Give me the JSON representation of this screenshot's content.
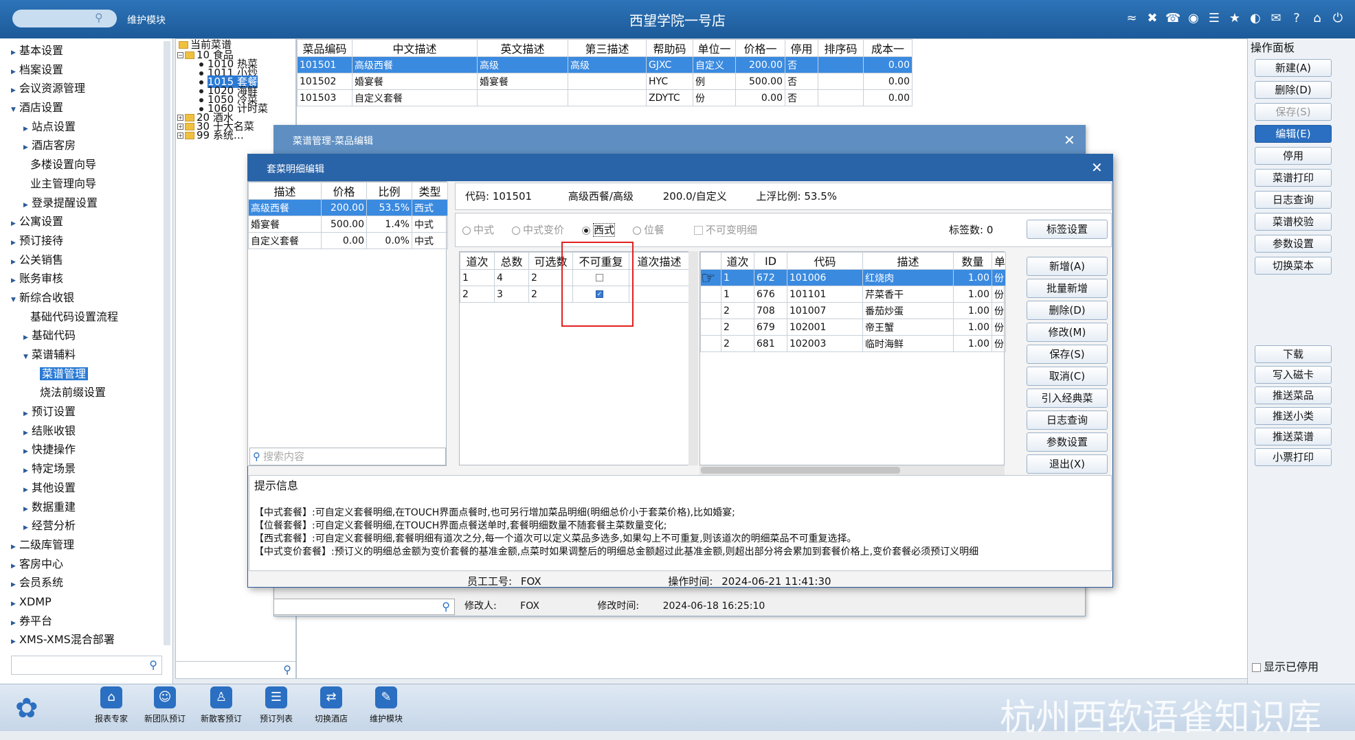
{
  "topbar": {
    "search_placeholder": "",
    "module_label": "维护模块",
    "title": "西望学院一号店",
    "icons": [
      "wifi-icon",
      "tools-icon",
      "phone-icon",
      "palette-icon",
      "menu-icon",
      "star-icon",
      "theme-icon",
      "mail-icon",
      "help-icon",
      "home-icon",
      "power-icon"
    ]
  },
  "left_nav": {
    "items": [
      {
        "label": "基本设置",
        "level": 0,
        "expanded": false
      },
      {
        "label": "档案设置",
        "level": 0,
        "expanded": false
      },
      {
        "label": "会议资源管理",
        "level": 0,
        "expanded": false
      },
      {
        "label": "酒店设置",
        "level": 0,
        "expanded": true
      },
      {
        "label": "站点设置",
        "level": 1,
        "expanded": false
      },
      {
        "label": "酒店客房",
        "level": 1,
        "expanded": false
      },
      {
        "label": "多楼设置向导",
        "level": 2
      },
      {
        "label": "业主管理向导",
        "level": 2
      },
      {
        "label": "登录提醒设置",
        "level": 1,
        "expanded": false
      },
      {
        "label": "公寓设置",
        "level": 0,
        "expanded": false
      },
      {
        "label": "预订接待",
        "level": 0,
        "expanded": false
      },
      {
        "label": "公关销售",
        "level": 0,
        "expanded": false
      },
      {
        "label": "账务审核",
        "level": 0,
        "expanded": false
      },
      {
        "label": "新综合收银",
        "level": 0,
        "expanded": true
      },
      {
        "label": "基础代码设置流程",
        "level": 2
      },
      {
        "label": "基础代码",
        "level": 1,
        "expanded": false
      },
      {
        "label": "菜谱辅料",
        "level": 1,
        "expanded": true
      },
      {
        "label": "菜谱管理",
        "level": 3,
        "active": true
      },
      {
        "label": "烧法前缀设置",
        "level": 3
      },
      {
        "label": "预订设置",
        "level": 1,
        "expanded": false
      },
      {
        "label": "结账收银",
        "level": 1,
        "expanded": false
      },
      {
        "label": "快捷操作",
        "level": 1,
        "expanded": false
      },
      {
        "label": "特定场景",
        "level": 1,
        "expanded": false
      },
      {
        "label": "其他设置",
        "level": 1,
        "expanded": false
      },
      {
        "label": "数据重建",
        "level": 1,
        "expanded": false
      },
      {
        "label": "经营分析",
        "level": 1,
        "expanded": false
      },
      {
        "label": "二级库管理",
        "level": 0,
        "expanded": false
      },
      {
        "label": "客房中心",
        "level": 0,
        "expanded": false
      },
      {
        "label": "会员系统",
        "level": 0,
        "expanded": false
      },
      {
        "label": "XDMP",
        "level": 0,
        "expanded": false
      },
      {
        "label": "券平台",
        "level": 0,
        "expanded": false
      },
      {
        "label": "XMS-XMS混合部署",
        "level": 0,
        "expanded": false
      }
    ]
  },
  "tree": {
    "root": "当前菜谱",
    "nodes": [
      {
        "label": "10 食品",
        "kind": "folder",
        "exp": "⊟"
      },
      {
        "label": "1010 热菜",
        "kind": "leaf"
      },
      {
        "label": "1011 小炒",
        "kind": "leaf"
      },
      {
        "label": "1015 套餐",
        "kind": "leaf",
        "selected": true
      },
      {
        "label": "1020 海鲜",
        "kind": "leaf"
      },
      {
        "label": "1050 冷菜",
        "kind": "leaf"
      },
      {
        "label": "1060 计时菜",
        "kind": "leaf"
      },
      {
        "label": "20 酒水",
        "kind": "folder",
        "exp": "⊞"
      },
      {
        "label": "30 十大名菜",
        "kind": "folder",
        "exp": "⊞"
      },
      {
        "label": "99 系统…",
        "kind": "folder",
        "exp": "⊞"
      }
    ]
  },
  "dish_table": {
    "headers": [
      "菜品编码",
      "中文描述",
      "英文描述",
      "第三描述",
      "帮助码",
      "单位一",
      "价格一",
      "停用",
      "排序码",
      "成本一"
    ],
    "rows": [
      [
        "101501",
        "高级西餐",
        "高级",
        "高级",
        "GJXC",
        "自定义",
        "200.00",
        "否",
        "",
        "0.00"
      ],
      [
        "101502",
        "婚宴餐",
        "婚宴餐",
        "",
        "HYC",
        "例",
        "500.00",
        "否",
        "",
        "0.00"
      ],
      [
        "101503",
        "自定义套餐",
        "",
        "",
        "ZDYTC",
        "份",
        "0.00",
        "否",
        "",
        "0.00"
      ]
    ]
  },
  "right_panel": {
    "title": "操作面板",
    "buttons": [
      {
        "label": "新建(A)"
      },
      {
        "label": "删除(D)"
      },
      {
        "label": "保存(S)",
        "disabled": true
      },
      {
        "label": "编辑(E)",
        "active": true
      },
      {
        "label": "停用"
      },
      {
        "label": "菜谱打印"
      },
      {
        "label": "日志查询"
      },
      {
        "label": "菜谱校验"
      },
      {
        "label": "参数设置"
      },
      {
        "label": "切换菜本"
      }
    ],
    "buttons2": [
      {
        "label": "下载"
      },
      {
        "label": "写入磁卡"
      },
      {
        "label": "推送菜品"
      },
      {
        "label": "推送小类"
      },
      {
        "label": "推送菜谱"
      },
      {
        "label": "小票打印"
      }
    ],
    "show_disabled": "显示已停用"
  },
  "back_dialog": {
    "title": "菜谱管理-菜品编辑",
    "modifier_label": "修改人:",
    "modifier": "FOX",
    "modify_time_label": "修改时间:",
    "modify_time": "2024-06-18 16:25:10"
  },
  "front_dialog": {
    "title": "套菜明细编辑",
    "pkg_headers": [
      "描述",
      "价格",
      "比例",
      "类型"
    ],
    "pkg_rows": [
      [
        "高级西餐",
        "200.00",
        "53.5%",
        "西式"
      ],
      [
        "婚宴餐",
        "500.00",
        "1.4%",
        "中式"
      ],
      [
        "自定义套餐",
        "0.00",
        "0.0%",
        "中式"
      ]
    ],
    "search_placeholder": "搜索内容",
    "info": {
      "code_label": "代码:",
      "code": "101501",
      "name": "高级西餐/高级",
      "price": "200.0/自定义",
      "ratio_label": "上浮比例:",
      "ratio": "53.5%"
    },
    "types": [
      {
        "label": "中式",
        "checked": false,
        "disabled": true
      },
      {
        "label": "中式变价",
        "checked": false,
        "disabled": true
      },
      {
        "label": "西式",
        "checked": true,
        "disabled": false
      },
      {
        "label": "位餐",
        "checked": false,
        "disabled": true
      }
    ],
    "non_variable_label": "不可变明细",
    "label_count": "标签数: 0",
    "label_settings_btn": "标签设置",
    "course_headers": [
      "道次",
      "总数",
      "可选数",
      "不可重复",
      "道次描述"
    ],
    "course_rows": [
      {
        "cells": [
          "1",
          "4",
          "2"
        ],
        "non_repeat": false,
        "desc": ""
      },
      {
        "cells": [
          "2",
          "3",
          "2"
        ],
        "non_repeat": true,
        "desc": ""
      }
    ],
    "detail_headers": [
      "道次",
      "ID",
      "代码",
      "描述",
      "数量",
      "单"
    ],
    "detail_rows": [
      [
        "1",
        "672",
        "101006",
        "红烧肉",
        "1.00",
        "份"
      ],
      [
        "1",
        "676",
        "101101",
        "芹菜香干",
        "1.00",
        "份"
      ],
      [
        "2",
        "708",
        "101007",
        "番茄炒蛋",
        "1.00",
        "份"
      ],
      [
        "2",
        "679",
        "102001",
        "帝王蟹",
        "1.00",
        "份"
      ],
      [
        "2",
        "681",
        "102003",
        "临时海鲜",
        "1.00",
        "份"
      ]
    ],
    "side_buttons": [
      "新增(A)",
      "批量新增",
      "删除(D)",
      "修改(M)",
      "保存(S)",
      "取消(C)",
      "引入经典菜",
      "日志查询",
      "参数设置",
      "退出(X)"
    ],
    "hint_title": "提示信息",
    "hints": [
      "【中式套餐】:可自定义套餐明细,在TOUCH界面点餐时,也可另行增加菜品明细(明细总价小于套菜价格),比如婚宴;",
      "【位餐套餐】:可自定义套餐明细,在TOUCH界面点餐送单时,套餐明细数量不随套餐主菜数量变化;",
      "【西式套餐】:可自定义套餐明细,套餐明细有道次之分,每一个道次可以定义菜品多选多,如果勾上不可重复,则该道次的明细菜品不可重复选择。",
      "【中式变价套餐】:预订义的明细总金额为变价套餐的基准金额,点菜时如果调整后的明细总金额超过此基准金额,则超出部分将会累加到套餐价格上,变价套餐必须预订义明细"
    ],
    "staff_label": "员工工号:",
    "staff": "FOX",
    "op_time_label": "操作时间:",
    "op_time": "2024-06-21 11:41:30"
  },
  "taskbar": {
    "items": [
      {
        "label": "报表专家",
        "icon": "report-icon"
      },
      {
        "label": "新团队预订",
        "icon": "team-icon"
      },
      {
        "label": "新散客预订",
        "icon": "guest-icon"
      },
      {
        "label": "预订列表",
        "icon": "list-icon"
      },
      {
        "label": "切换酒店",
        "icon": "switch-icon"
      },
      {
        "label": "维护模块",
        "icon": "wrench-icon"
      }
    ],
    "watermark": "杭州西软语雀知识库"
  }
}
